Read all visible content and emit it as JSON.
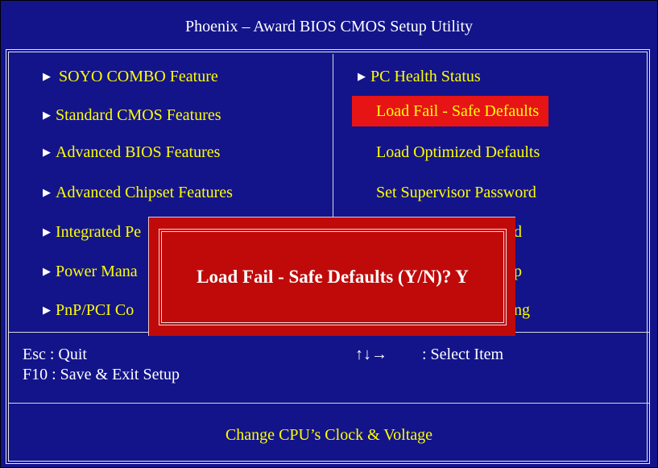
{
  "title": "Phoenix – Award BIOS CMOS Setup Utility",
  "left_menu": [
    "SOYO COMBO Feature",
    "Standard CMOS Features",
    "Advanced BIOS Features",
    "Advanced Chipset Features",
    "Integrated Pe",
    "Power Mana",
    "PnP/PCI Co"
  ],
  "right_menu": {
    "item0": "PC Health Status",
    "item1": "Load Fail - Safe Defaults",
    "item2": "Load Optimized Defaults",
    "item3": "Set Supervisor Password",
    "item4_fragment": "d",
    "item5_fragment": "p",
    "item6_fragment": "ng"
  },
  "help": {
    "esc": "Esc : Quit",
    "f10": "F10 : Save & Exit Setup",
    "arrows": "↑↓→",
    "select": ": Select Item"
  },
  "status": "Change CPU’s Clock & Voltage",
  "dialog": {
    "text": "Load Fail - Safe Defaults (Y/N)? Y"
  },
  "colors": {
    "background": "#13148a",
    "highlight": "#e71416",
    "dialog": "#c00a0a",
    "menu_text": "#ffff00"
  }
}
